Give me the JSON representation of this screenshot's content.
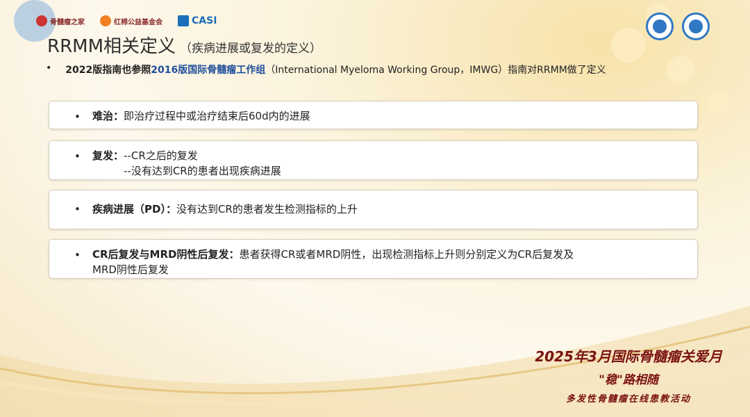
{
  "logos": [
    {
      "name": "骨髓瘤之家",
      "color": "#8a2c2c"
    },
    {
      "name": "红棉公益基金会",
      "color": "#8a2c2c"
    },
    {
      "name": "CASI",
      "color": "#1a6fb8"
    }
  ],
  "title": "RRMM相关定义",
  "subtitle": "（疾病进展或复发的定义）",
  "intro": {
    "part1": "2022版指南也参照",
    "part2": "2016版国际骨髓瘤工作组",
    "part3": "（International Myeloma Working Group，IMWG）指南对RRMM做了定义"
  },
  "cards": [
    {
      "term": "难治：",
      "line1": "即治疗过程中或治疗结束后60d内的进展",
      "line2": ""
    },
    {
      "term": "复发：",
      "line1": "--CR之后的复发",
      "line2": "--没有达到CR的患者出现疾病进展"
    },
    {
      "term": "疾病进展（PD）：",
      "line1": "没有达到CR的患者发生检测指标的上升",
      "line2": ""
    },
    {
      "term": "CR后复发与MRD阴性后复发：",
      "line1": "患者获得CR或者MRD阴性，出现检测指标上升则分别定义为CR后复发及",
      "line2": "MRD阴性后复发"
    }
  ],
  "bullet": "•",
  "footer": {
    "line1": "2025年3月国际骨髓瘤关爱月",
    "line2": "\"稳\"路相随",
    "line3": "多发性骨髓瘤在线患教活动"
  },
  "colors": {
    "accent": "#1f4e9a",
    "footer": "#7a1212"
  }
}
